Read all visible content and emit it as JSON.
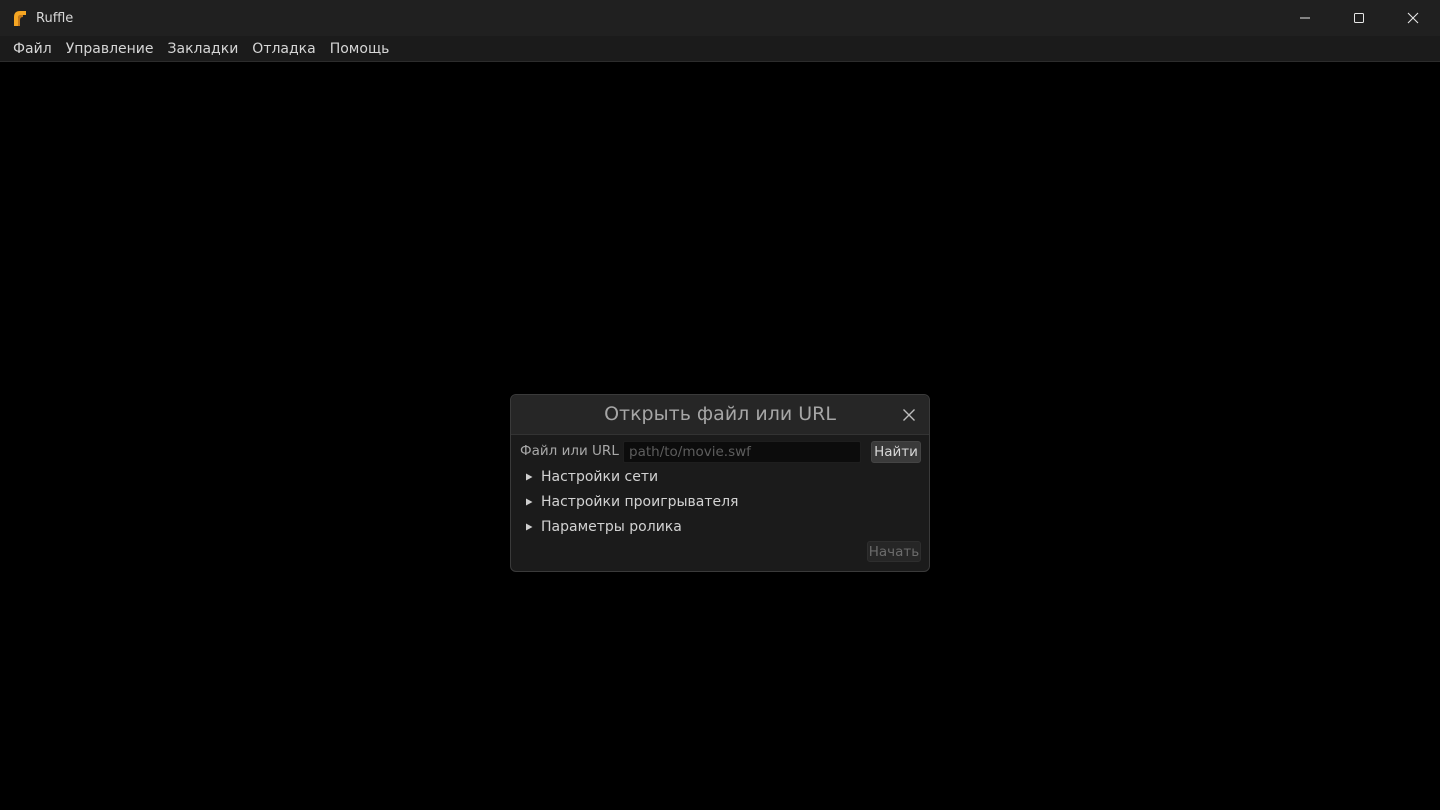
{
  "window": {
    "title": "Ruffle",
    "icon": "ruffle-logo-icon",
    "controls": [
      "minimize-icon",
      "maximize-icon",
      "close-icon"
    ]
  },
  "menu": {
    "items": [
      {
        "label": "Файл"
      },
      {
        "label": "Управление"
      },
      {
        "label": "Закладки"
      },
      {
        "label": "Отладка"
      },
      {
        "label": "Помощь"
      }
    ]
  },
  "dialog": {
    "title": "Открыть файл или URL",
    "field_label": "Файл или URL",
    "url_value": "",
    "url_placeholder": "path/to/movie.swf",
    "browse_label": "Найти",
    "sections": [
      {
        "label": "Настройки сети"
      },
      {
        "label": "Настройки проигрывателя"
      },
      {
        "label": "Параметры ролика"
      }
    ],
    "start_label": "Начать"
  },
  "colors": {
    "titlebar_bg": "#202020",
    "menubar_bg": "#1b1b1b",
    "player_bg": "#000000",
    "dialog_bg": "#1b1b1b",
    "logo_accent": "#f5a623"
  }
}
